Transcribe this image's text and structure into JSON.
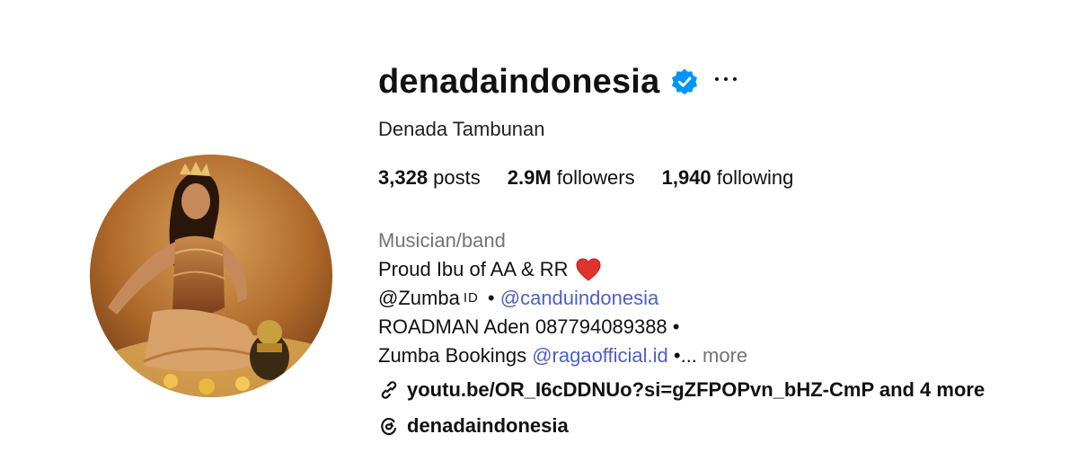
{
  "profile": {
    "username": "denadaindonesia",
    "full_name": "Denada Tambunan",
    "verified": true
  },
  "stats": {
    "posts_count": "3,328",
    "posts_label": " posts",
    "followers_count": "2.9M",
    "followers_label": " followers",
    "following_count": "1,940",
    "following_label": " following"
  },
  "bio": {
    "category": "Musician/band",
    "line1": "Proud Ibu of AA & RR",
    "line2_prefix": "@Zumba",
    "line2_id": "ID",
    "line2_sep": " • ",
    "line2_mention": "@canduindonesia",
    "line3": "ROADMAN Aden 087794089388 •",
    "line4_prefix": "Zumba Bookings ",
    "line4_mention": "@ragaofficial.id",
    "line4_suffix": " •...",
    "more_label": " more"
  },
  "links": {
    "primary_link": "youtu.be/OR_I6cDDNUo?si=gZFPOPvn_bHZ-CmP and 4 more",
    "threads_handle": "denadaindonesia"
  },
  "colors": {
    "verified_badge": "#0095f6",
    "mention": "#4e5fc7",
    "heart": "#e0322f",
    "secondary_text": "#737373"
  },
  "icons": {
    "verified": "verified-badge-icon",
    "options": "more-options-icon",
    "heart": "red-heart-icon",
    "link": "link-icon",
    "threads": "threads-icon"
  }
}
